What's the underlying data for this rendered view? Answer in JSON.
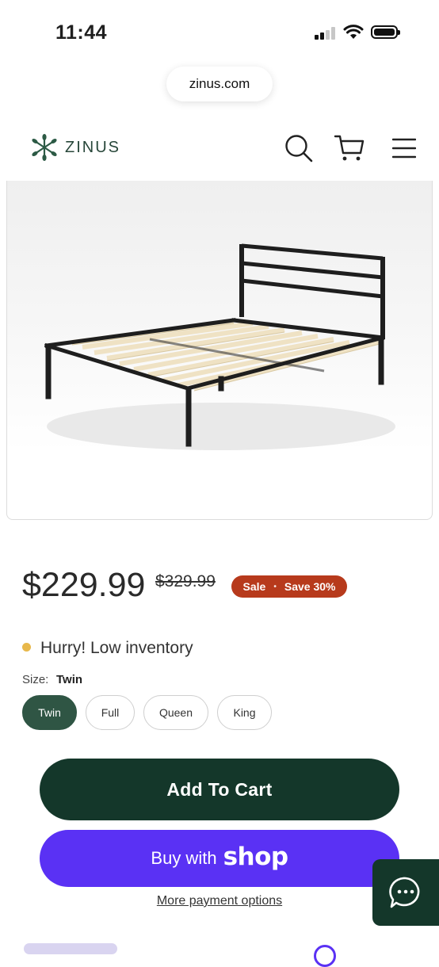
{
  "status_bar": {
    "time": "11:44"
  },
  "browser": {
    "url": "zinus.com"
  },
  "header": {
    "logo_text": "ZINUS"
  },
  "product": {
    "price": "$229.99",
    "compare_price": "$329.99",
    "sale_label": "Sale",
    "save_label": "Save 30%",
    "inventory_text": "Hurry! Low inventory",
    "size_label": "Size:",
    "size_selected": "Twin",
    "sizes": [
      "Twin",
      "Full",
      "Queen",
      "King"
    ]
  },
  "actions": {
    "add_to_cart": "Add To Cart",
    "buy_with": "Buy with",
    "shop_word": "shop",
    "more_payment": "More payment options"
  },
  "colors": {
    "brand_green": "#14372a",
    "shop_purple": "#5a31f4",
    "sale_red": "#b73a1c",
    "inventory_dot": "#e8b84b"
  }
}
